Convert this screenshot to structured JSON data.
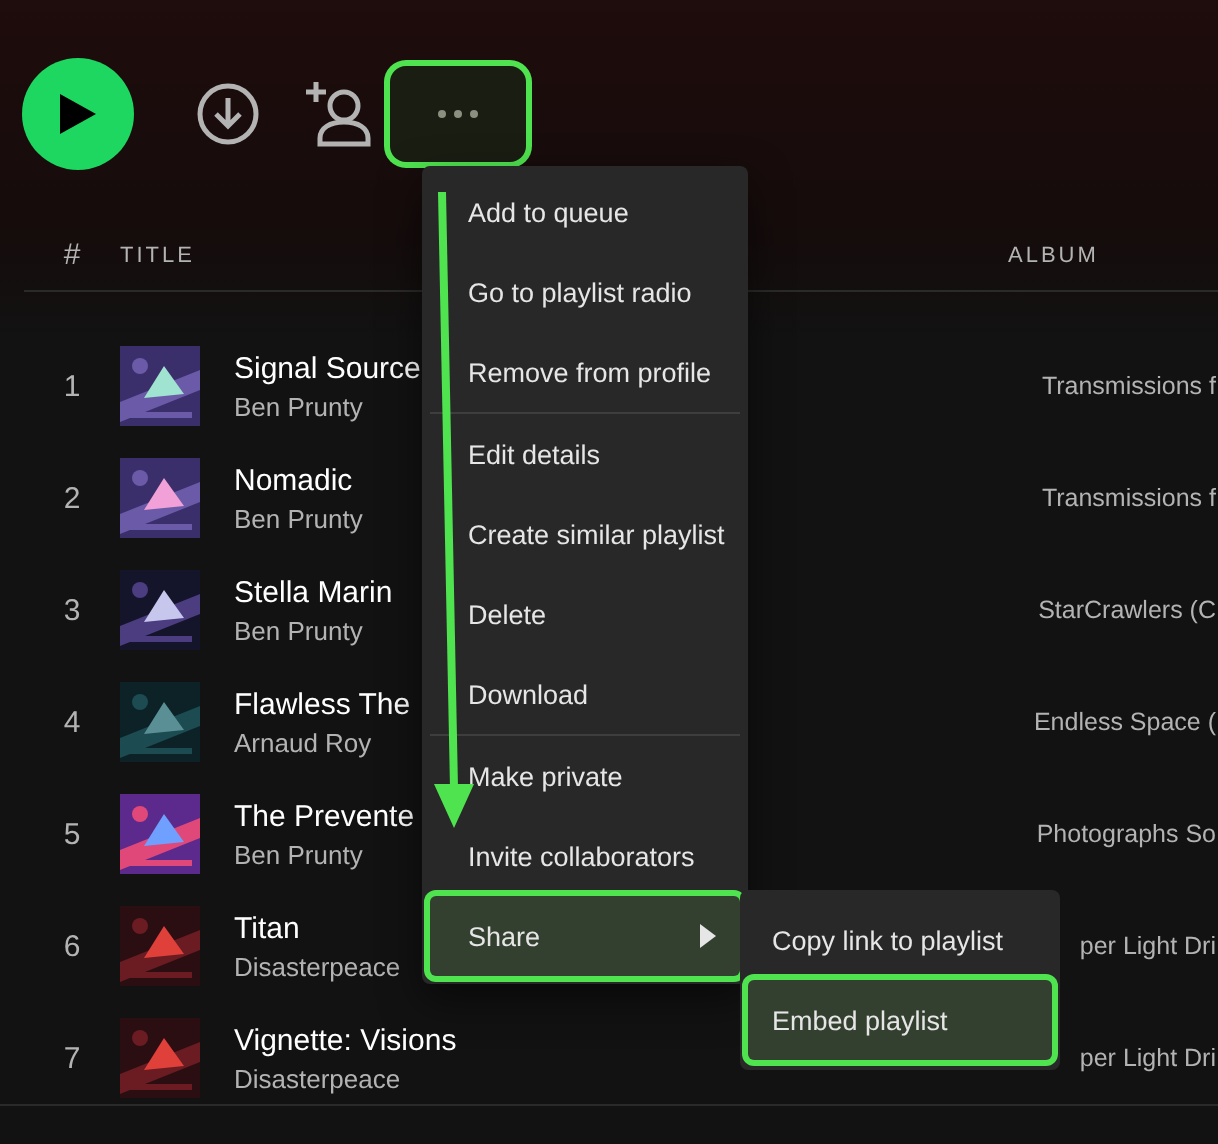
{
  "toolbar": {
    "more_button": {
      "annotated": true
    }
  },
  "columns": {
    "number": "#",
    "title": "TITLE",
    "album": "ALBUM"
  },
  "rows": [
    {
      "number": "1",
      "title": "Signal Source",
      "artist": "Ben Prunty",
      "album": "Transmissions f"
    },
    {
      "number": "2",
      "title": "Nomadic",
      "artist": "Ben Prunty",
      "album": "Transmissions f"
    },
    {
      "number": "3",
      "title": "Stella Marin",
      "artist": "Ben Prunty",
      "album": "StarCrawlers (C"
    },
    {
      "number": "4",
      "title": "Flawless The",
      "artist": "Arnaud Roy",
      "album": "Endless Space ("
    },
    {
      "number": "5",
      "title": "The Prevente",
      "artist": "Ben Prunty",
      "album": "Photographs So"
    },
    {
      "number": "6",
      "title": "Titan",
      "artist": "Disasterpeace",
      "album": "per Light Dri"
    },
    {
      "number": "7",
      "title": "Vignette: Visions",
      "artist": "Disasterpeace",
      "album": "per Light Dri"
    }
  ],
  "menu": {
    "sections": [
      {
        "items": [
          {
            "label": "Add to queue",
            "selected": false,
            "annotated": false
          },
          {
            "label": "Go to playlist radio",
            "selected": false,
            "annotated": false
          },
          {
            "label": "Remove from profile",
            "selected": false,
            "annotated": false
          }
        ]
      },
      {
        "items": [
          {
            "label": "Edit details",
            "selected": false,
            "annotated": false
          },
          {
            "label": "Create similar playlist",
            "selected": false,
            "annotated": false
          },
          {
            "label": "Delete",
            "selected": false,
            "annotated": false
          },
          {
            "label": "Download",
            "selected": false,
            "annotated": false
          }
        ]
      },
      {
        "items": [
          {
            "label": "Make private",
            "selected": false,
            "annotated": false
          },
          {
            "label": "Invite collaborators",
            "selected": false,
            "annotated": false
          },
          {
            "label": "Share",
            "selected": true,
            "annotated": true,
            "submenu": true
          }
        ]
      }
    ],
    "submenu": [
      {
        "label": "Copy link to playlist",
        "selected": false,
        "annotated": false
      },
      {
        "label": "Embed playlist",
        "selected": true,
        "annotated": true
      }
    ]
  }
}
